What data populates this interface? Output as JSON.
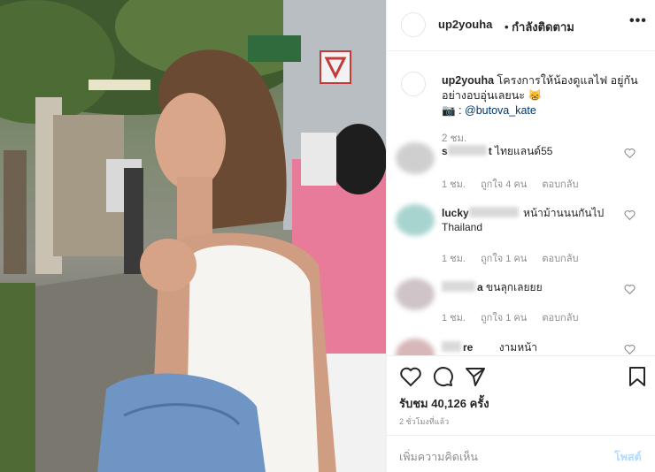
{
  "post": {
    "username": "up2youha",
    "follow_status": "• กำลังติดตาม",
    "more_icon": "more-horizontal-icon",
    "caption_text": "โครงการให้น้องดูแลไฟ อยู่กันอย่างอบอุ่นเลยนะ",
    "caption_emoji": "😸",
    "camera_emoji": "📷",
    "caption_credit_prefix": ":",
    "caption_mention": "@butova_kate",
    "caption_time": "2 ชม."
  },
  "comments": [
    {
      "username_visible": "s",
      "username_tail": "t",
      "text": "ไทยแลนด์55",
      "time": "1 ชม.",
      "likes": "ถูกใจ 4 คน",
      "reply": "ตอบกลับ"
    },
    {
      "username_visible": "lucky",
      "username_tail": "",
      "text": "หน้าม้านนนกันไป Thailand",
      "time": "1 ชม.",
      "likes": "ถูกใจ 1 คน",
      "reply": "ตอบกลับ"
    },
    {
      "username_visible": "",
      "username_tail": "a",
      "text": "ขนลุกเลยยย",
      "time": "1 ชม.",
      "likes": "ถูกใจ 1 คน",
      "reply": "ตอบกลับ"
    },
    {
      "username_visible": "",
      "username_tail": "re",
      "text": "งามหน้า",
      "time": "",
      "likes": "",
      "reply": ""
    }
  ],
  "actions": {
    "like_icon": "heart-icon",
    "comment_icon": "comment-icon",
    "share_icon": "share-icon",
    "save_icon": "bookmark-icon",
    "likes_label": "รับชม 40,126 ครั้ง",
    "post_time": "2 ชั่วโมงที่แล้ว"
  },
  "add_comment": {
    "placeholder": "เพิ่มความคิดเห็น",
    "post_label": "โพสต์"
  },
  "media": {
    "sign_icon": "subway-logo-icon"
  },
  "colors": {
    "mention": "#003569",
    "post_button": "#b3dbff",
    "secondary_text": "#8e8e8e"
  }
}
